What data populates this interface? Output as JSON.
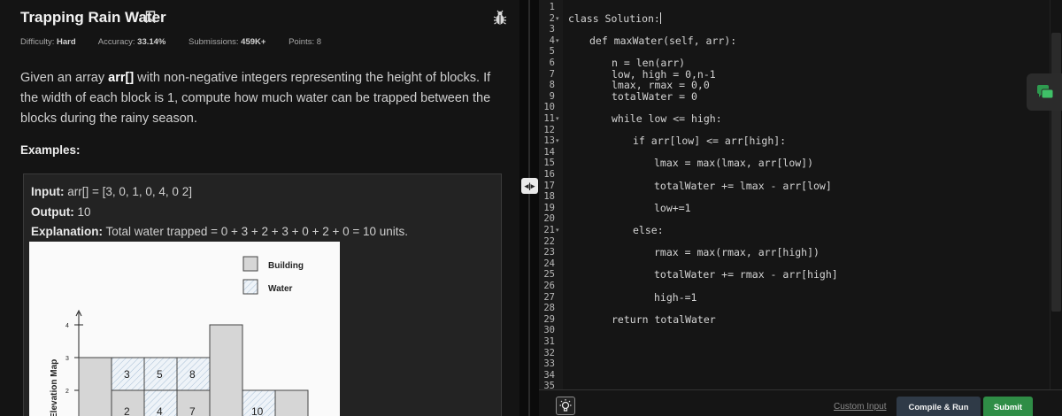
{
  "problem": {
    "title": "Trapping Rain Water",
    "meta": [
      {
        "label": "Difficulty:",
        "value": "Hard"
      },
      {
        "label": "Accuracy:",
        "value": "33.14%"
      },
      {
        "label": "Submissions:",
        "value": "459K+"
      },
      {
        "label": "Points:",
        "value": "8"
      }
    ],
    "description_pre": "Given an array ",
    "description_bold": "arr[]",
    "description_post": " with non-negative integers representing the height of blocks. If the width of each block is 1, compute how much water can be trapped between the blocks during the rainy season.",
    "examples_heading": "Examples:",
    "example": {
      "input_label": "Input:",
      "input_value": "arr[]  =  [3,  0,  1,  0,  4,  0  2]",
      "output_label": "Output:",
      "output_value": "10",
      "explanation_label": "Explanation:",
      "explanation_value": "Total  water  trapped  =  0  +  3  +  2  +  3  +  0  +  2  +  0  =  10  units."
    }
  },
  "chart_data": {
    "type": "bar",
    "ylabel": "Elevation Map",
    "yticks": [
      "2",
      "3",
      "4"
    ],
    "legend": [
      "Building",
      "Water"
    ],
    "water_labels": [
      "3",
      "5",
      "8",
      "2",
      "4",
      "7",
      "10"
    ]
  },
  "editor": {
    "line_numbers": [
      "1",
      "2",
      "3",
      "4",
      "5",
      "6",
      "7",
      "8",
      "9",
      "10",
      "11",
      "12",
      "13",
      "14",
      "15",
      "16",
      "17",
      "18",
      "19",
      "20",
      "21",
      "22",
      "23",
      "24",
      "25",
      "26",
      "27",
      "28",
      "29",
      "30",
      "31",
      "32",
      "33",
      "34",
      "35"
    ],
    "fold_lines": [
      "2",
      "4",
      "11",
      "13",
      "21"
    ],
    "code": [
      {
        "line": 2,
        "text": "class Solution:"
      },
      {
        "line": 4,
        "text": "def maxWater(self, arr):"
      },
      {
        "line": 6,
        "text": "n = len(arr)"
      },
      {
        "line": 7,
        "text": "low, high = 0,n-1"
      },
      {
        "line": 8,
        "text": "lmax, rmax = 0,0"
      },
      {
        "line": 9,
        "text": "totalWater = 0"
      },
      {
        "line": 11,
        "text": "while low <= high:"
      },
      {
        "line": 13,
        "text": "if arr[low] <= arr[high]:"
      },
      {
        "line": 15,
        "text": "lmax = max(lmax, arr[low])"
      },
      {
        "line": 17,
        "text": "totalWater += lmax - arr[low]"
      },
      {
        "line": 19,
        "text": "low+=1"
      },
      {
        "line": 21,
        "text": "else:"
      },
      {
        "line": 23,
        "text": "rmax = max(rmax, arr[high])"
      },
      {
        "line": 25,
        "text": "totalWater += rmax - arr[high]"
      },
      {
        "line": 27,
        "text": "high-=1"
      },
      {
        "line": 29,
        "text": "return totalWater"
      }
    ]
  },
  "bottombar": {
    "custom_input": "Custom Input",
    "compile_run": "Compile & Run",
    "submit": "Submit"
  },
  "colors": {
    "submit": "#2f8d46",
    "compile": "#2f3a47",
    "chat_icon": "#2e9b4f"
  }
}
